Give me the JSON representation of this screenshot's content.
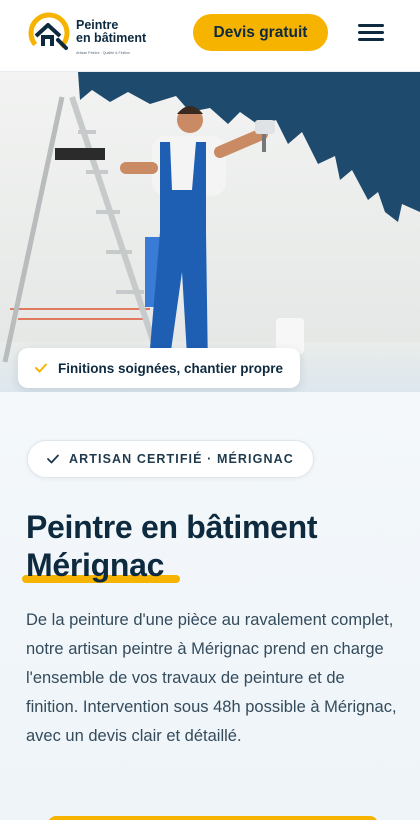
{
  "header": {
    "logo": {
      "line1": "Peintre",
      "line2": "en bâtiment",
      "tagline": "Artisan Peintre · Qualité & Finition"
    },
    "cta_label": "Devis gratuit",
    "menu_icon": "hamburger-menu-icon"
  },
  "hero": {
    "image_alt": "Peintre en bâtiment sur un escabeau peignant un mur en bleu",
    "feature_pill": "Finitions soignées, chantier propre"
  },
  "content": {
    "badge": "ARTISAN CERTIFIÉ · MÉRIGNAC",
    "title_line1": "Peintre en bâtiment",
    "title_line2": "Mérignac",
    "description": "De la peinture d'une pièce au ravalement complet, notre artisan peintre à Mérignac prend en charge l'ensemble de vos travaux de peinture et de finition. Intervention sous 48h possible à Mérignac, avec un devis clair et détaillé."
  },
  "colors": {
    "accent": "#f6b300",
    "navy": "#0e2a3f",
    "wall_blue": "#1e4a6d"
  }
}
